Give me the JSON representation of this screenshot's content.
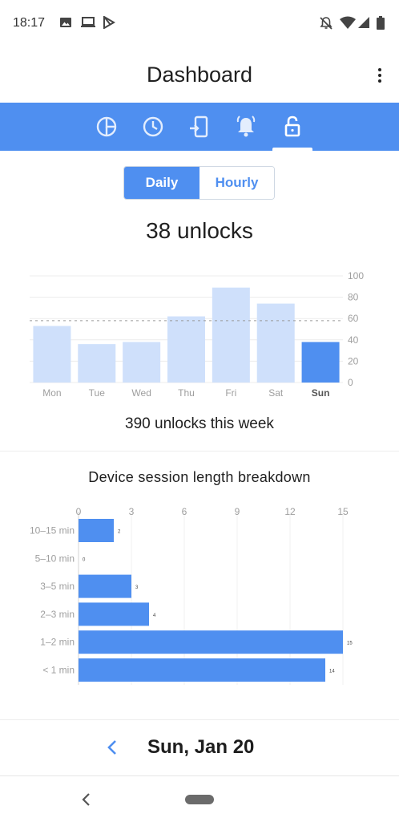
{
  "status_bar": {
    "time": "18:17",
    "left_icons": [
      "image-icon",
      "laptop-icon",
      "play-store-icon"
    ],
    "right_icons": [
      "notifications-off-icon",
      "wifi-icon",
      "signal-icon",
      "battery-icon"
    ]
  },
  "app_bar": {
    "title": "Dashboard",
    "menu_icon": "more-vert-icon"
  },
  "tabs": [
    {
      "icon": "pie-chart-icon",
      "selected": false
    },
    {
      "icon": "clock-icon",
      "selected": false
    },
    {
      "icon": "phone-touch-icon",
      "selected": false
    },
    {
      "icon": "bell-icon",
      "selected": false
    },
    {
      "icon": "lock-open-icon",
      "selected": true
    }
  ],
  "toggle": {
    "daily": "Daily",
    "hourly": "Hourly",
    "selected": "Daily"
  },
  "headline": "38 unlocks",
  "week_total": "390 unlocks this week",
  "breakdown_title": "Device session length breakdown",
  "date_nav": {
    "date": "Sun, Jan 20"
  },
  "colors": {
    "accent": "#4f8ff0",
    "bar_light": "#cfe0fb",
    "text": "#212121"
  },
  "chart_data": [
    {
      "type": "bar",
      "categories": [
        "Mon",
        "Tue",
        "Wed",
        "Thu",
        "Fri",
        "Sat",
        "Sun"
      ],
      "values": [
        53,
        36,
        38,
        62,
        89,
        74,
        38
      ],
      "highlighted": "Sun",
      "average_line": 58,
      "ylim": [
        0,
        100
      ],
      "yticks": [
        0,
        20,
        40,
        60,
        80,
        100
      ],
      "grid": true,
      "y_axis_side": "right"
    },
    {
      "type": "bar",
      "orientation": "horizontal",
      "categories": [
        "10–15 min",
        "5–10 min",
        "3–5 min",
        "2–3 min",
        "1–2 min",
        "< 1 min"
      ],
      "values": [
        2,
        0,
        3,
        4,
        15,
        14
      ],
      "xlim": [
        0,
        15
      ],
      "xticks": [
        0,
        3,
        6,
        9,
        12,
        15
      ],
      "grid": true,
      "x_axis_side": "top"
    }
  ]
}
